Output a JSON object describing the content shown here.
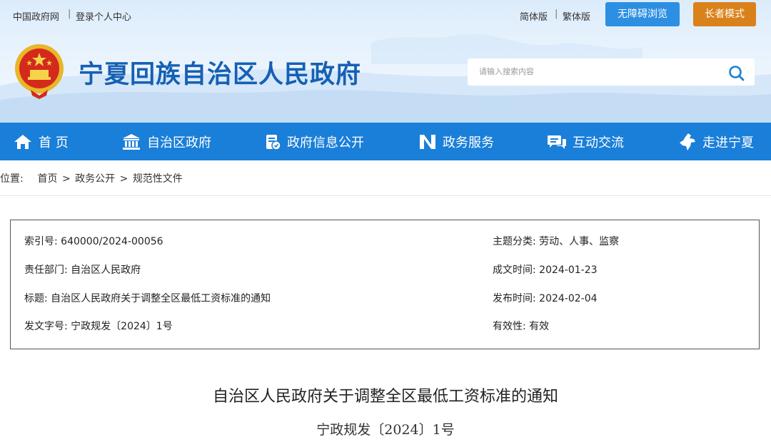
{
  "topbar": {
    "gov_portal": "中国政府网",
    "login": "登录个人中心",
    "simplified": "简体版",
    "traditional": "繁体版",
    "accessibility": "无障碍浏览",
    "elder_mode": "长者模式",
    "accessibility_color": "#2d8fe2",
    "elder_color": "#d9821b"
  },
  "header": {
    "site_title": "宁夏回族自治区人民政府",
    "emblem_icon": "national-emblem-icon",
    "title_color": "#1560b4"
  },
  "search": {
    "placeholder": "请输入搜索内容",
    "icon": "search-icon"
  },
  "nav": {
    "color": "#1a7fd8",
    "items": [
      {
        "label": "首 页",
        "icon": "home-icon"
      },
      {
        "label": "自治区政府",
        "icon": "government-building-icon"
      },
      {
        "label": "政府信息公开",
        "icon": "info-document-icon"
      },
      {
        "label": "政务服务",
        "icon": "service-n-icon"
      },
      {
        "label": "互动交流",
        "icon": "chat-icon"
      },
      {
        "label": "走进宁夏",
        "icon": "ningxia-map-icon"
      }
    ]
  },
  "breadcrumb": {
    "prefix": "位置:",
    "items": [
      "首页",
      "政务公开",
      "规范性文件"
    ],
    "separator": ">"
  },
  "info": {
    "index_no": "索引号: 640000/2024-00056",
    "topic": "主题分类: 劳动、人事、监察",
    "department": "责任部门: 自治区人民政府",
    "written_date": "成文时间: 2024-01-23",
    "title": "标题: 自治区人民政府关于调整全区最低工资标准的通知",
    "publish_date": "发布时间: 2024-02-04",
    "doc_no": "发文字号: 宁政规发〔2024〕1号",
    "validity": "有效性: 有效"
  },
  "article": {
    "title": "自治区人民政府关于调整全区最低工资标准的通知",
    "doc_number": "宁政规发〔2024〕1号"
  }
}
